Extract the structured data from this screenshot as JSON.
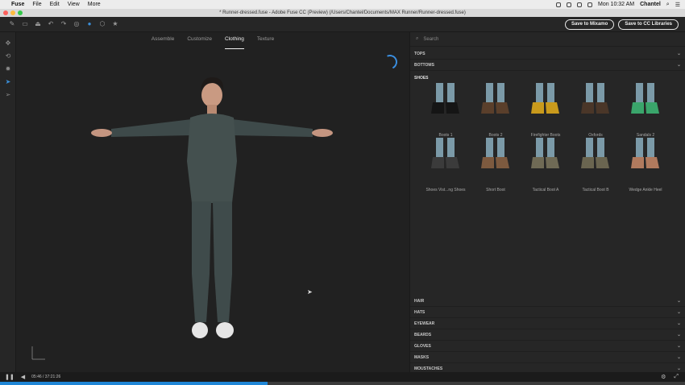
{
  "menubar": {
    "app": "Fuse",
    "items": [
      "File",
      "Edit",
      "View",
      "More"
    ],
    "clock": "Mon 10:32 AM",
    "user": "Chantel"
  },
  "window": {
    "title": "* Runner-dressed.fuse - Adobe Fuse CC (Preview) (/Users/Chantel/Documents/MAX Runner/Runner-dressed.fuse)"
  },
  "toolbar": {
    "save_mixamo": "Save to Mixamo",
    "save_cc": "Save to CC Libraries"
  },
  "viewport": {
    "tabs": [
      "Assemble",
      "Customize",
      "Clothing",
      "Texture"
    ],
    "active_tab": "Clothing"
  },
  "panel": {
    "search_placeholder": "Search",
    "top_sections": [
      "TOPS",
      "BOTTOMS"
    ],
    "open_section": "SHOES",
    "shoes": [
      {
        "label": "Boots 1",
        "color": "#151515"
      },
      {
        "label": "Boots 2",
        "color": "#5a3f2b"
      },
      {
        "label": "Firefighter Boots",
        "color": "#c99a1c"
      },
      {
        "label": "Oxfords",
        "color": "#4a3628"
      },
      {
        "label": "Sandals 2",
        "color": "#3aa56b"
      },
      {
        "label": "Shoes Vist...ng Shoes",
        "color": "#3b3b3b"
      },
      {
        "label": "Short Boot",
        "color": "#7d5a3f"
      },
      {
        "label": "Tactical Boot A",
        "color": "#6f6a55"
      },
      {
        "label": "Tactical Boot B",
        "color": "#6a6550"
      },
      {
        "label": "Wedge Ankle Heel",
        "color": "#b07a5e"
      }
    ],
    "bottom_sections": [
      "HAIR",
      "HATS",
      "EYEWEAR",
      "BEARDS",
      "GLOVES",
      "MASKS",
      "MOUSTACHES"
    ]
  },
  "playback": {
    "time": "05:46 / 37:21:26",
    "progress": 0.39
  }
}
